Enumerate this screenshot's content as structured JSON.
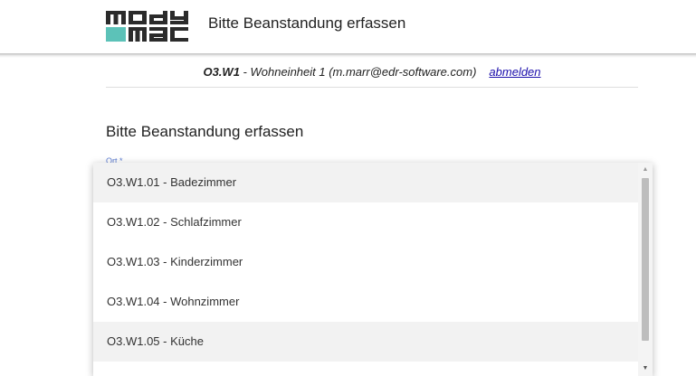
{
  "header": {
    "logo_text": "mody mac",
    "title": "Bitte Beanstandung erfassen"
  },
  "userbar": {
    "unit_code": "O3.W1",
    "unit_desc": " - Wohneinheit 1 (m.marr@edr-software.com)",
    "logout_label": "abmelden"
  },
  "main": {
    "title": "Bitte Beanstandung erfassen",
    "field_label": "Ort *"
  },
  "dropdown": {
    "options": [
      "O3.W1.01 - Badezimmer",
      "O3.W1.02 - Schlafzimmer",
      "O3.W1.03 - Kinderzimmer",
      "O3.W1.04 - Wohnzimmer",
      "O3.W1.05 - Küche"
    ],
    "highlighted_options": [
      0,
      4
    ]
  },
  "colors": {
    "logo_dark": "#2b2b2b",
    "logo_teal": "#5cc2b8",
    "link": "#1a0dab",
    "label": "#5b7bd0"
  }
}
